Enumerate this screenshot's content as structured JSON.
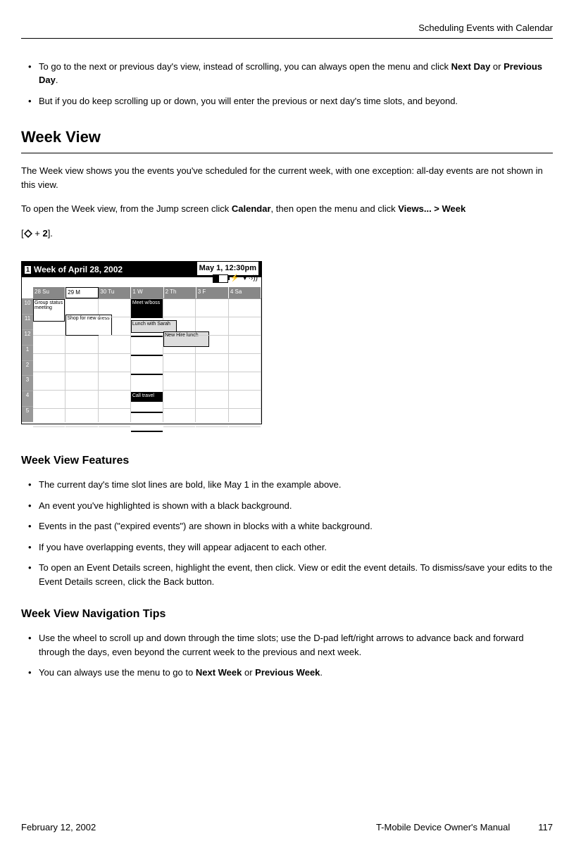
{
  "header": {
    "section_title": "Scheduling Events with Calendar"
  },
  "intro_bullets": [
    {
      "pre": "To go to the next or previous day's view, instead of scrolling, you can always open the menu and click ",
      "bold1": "Next Day",
      "mid": " or ",
      "bold2": "Previous Day",
      "post": "."
    },
    {
      "text": "But if you do keep scrolling up or down, you will enter the previous or next day's time slots, and beyond."
    }
  ],
  "week_view": {
    "heading": "Week View",
    "para1": "The Week view shows you the events you've scheduled for the current week, with one exception: all-day events are not shown in this view.",
    "para2_pre": "To open the Week view, from the Jump screen click ",
    "para2_b1": "Calendar",
    "para2_mid1": ", then open the menu and click ",
    "para2_b2": "Views... > Week",
    "shortcut_open": "[",
    "shortcut_plus": " + ",
    "shortcut_key": "2",
    "shortcut_close": "]."
  },
  "screenshot": {
    "title": "Week of April 28, 2002",
    "datetime": "May 1, 12:30pm",
    "days": [
      {
        "num": "28",
        "abbr": "Su"
      },
      {
        "num": "29",
        "abbr": "M"
      },
      {
        "num": "30",
        "abbr": "Tu"
      },
      {
        "num": "1",
        "abbr": "W"
      },
      {
        "num": "2",
        "abbr": "Th"
      },
      {
        "num": "3",
        "abbr": "F"
      },
      {
        "num": "4",
        "abbr": "Sa"
      }
    ],
    "hours": [
      "10",
      "11",
      "12",
      "1",
      "2",
      "3",
      "4",
      "5"
    ],
    "events": {
      "group_meeting": "Group status meeting",
      "shop_dress": "Shop for new dress",
      "meet_boss": "Meet w/boss",
      "lunch_sarah": "Lunch with Sarah",
      "new_hire": "New Hire lunch",
      "call_travel": "Call travel"
    }
  },
  "features": {
    "heading": "Week View Features",
    "bullets": [
      "The current day's time slot lines are bold, like May 1 in the example above.",
      "An event you've highlighted is shown with a black background.",
      "Events in the past (\"expired events\") are shown in blocks with a white background.",
      "If you have overlapping events, they will appear adjacent to each other.",
      "To open an Event Details screen, highlight the event, then click. View or edit the event details. To dismiss/save your edits to the Event Details screen, click the Back button."
    ]
  },
  "nav_tips": {
    "heading": "Week View Navigation Tips",
    "bullet1": "Use the wheel to scroll up and down through the time slots; use the D-pad left/right arrows to advance back and forward through the days, even beyond the current week to the previous and next week.",
    "bullet2_pre": "You can always use the menu to go to ",
    "bullet2_b1": "Next Week",
    "bullet2_mid": " or ",
    "bullet2_b2": "Previous Week",
    "bullet2_post": "."
  },
  "footer": {
    "date": "February 12, 2002",
    "manual": "T-Mobile Device Owner's Manual",
    "page": "117"
  }
}
